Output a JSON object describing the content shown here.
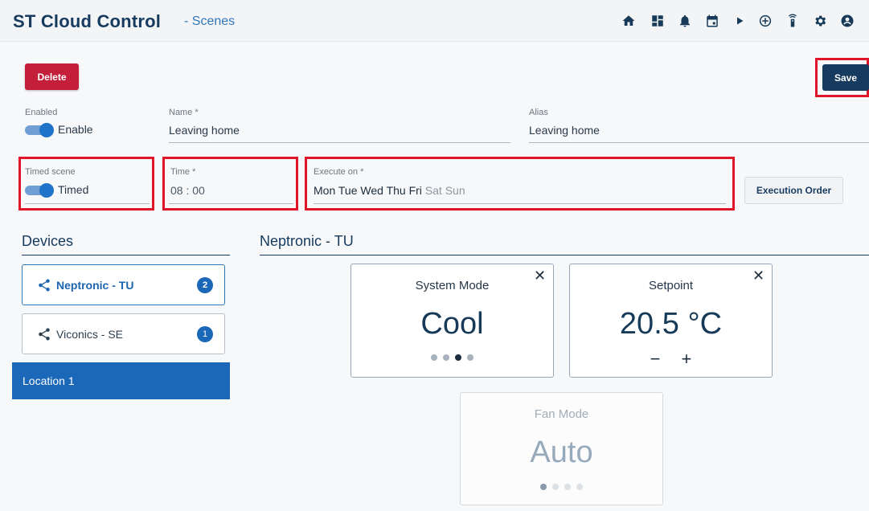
{
  "header": {
    "brand": "ST Cloud Control",
    "subtitle": "- Scenes",
    "icons": [
      "home-icon",
      "dashboard-icon",
      "bell-icon",
      "calendar-icon",
      "play-icon",
      "add-circle-icon",
      "remote-icon",
      "gear-icon",
      "account-icon"
    ]
  },
  "actions": {
    "delete": "Delete",
    "save": "Save",
    "execution_order": "Execution Order"
  },
  "form": {
    "enabled": {
      "label": "Enabled",
      "value": "Enable"
    },
    "name": {
      "label": "Name *",
      "value": "Leaving home"
    },
    "alias": {
      "label": "Alias",
      "value": "Leaving home"
    },
    "timed": {
      "label": "Timed scene",
      "value": "Timed"
    },
    "time": {
      "label": "Time *",
      "value": "08 : 00"
    },
    "execute": {
      "label": "Execute on *",
      "days": [
        {
          "d": "Mon",
          "on": true
        },
        {
          "d": "Tue",
          "on": true
        },
        {
          "d": "Wed",
          "on": true
        },
        {
          "d": "Thu",
          "on": true
        },
        {
          "d": "Fri",
          "on": true
        },
        {
          "d": "Sat",
          "on": false
        },
        {
          "d": "Sun",
          "on": false
        }
      ]
    }
  },
  "devices": {
    "title": "Devices",
    "items": [
      {
        "label": "Neptronic - TU",
        "count": "2",
        "active": true
      },
      {
        "label": "Viconics - SE",
        "count": "1",
        "active": false
      }
    ],
    "location": "Location 1"
  },
  "panel": {
    "title": "Neptronic - TU",
    "cards": [
      {
        "title": "System Mode",
        "value": "Cool",
        "dots_total": 4,
        "dot_active": 3
      },
      {
        "title": "Setpoint",
        "value": "20.5 °C",
        "minus": "−",
        "plus": "+"
      },
      {
        "title": "Fan Mode",
        "value": "Auto",
        "dots_total": 4,
        "dot_active": 1
      }
    ]
  },
  "colors": {
    "brand": "#173a5f",
    "accent": "#1b67b8",
    "delete": "#c41f3a",
    "highlight": "#e0152a"
  }
}
